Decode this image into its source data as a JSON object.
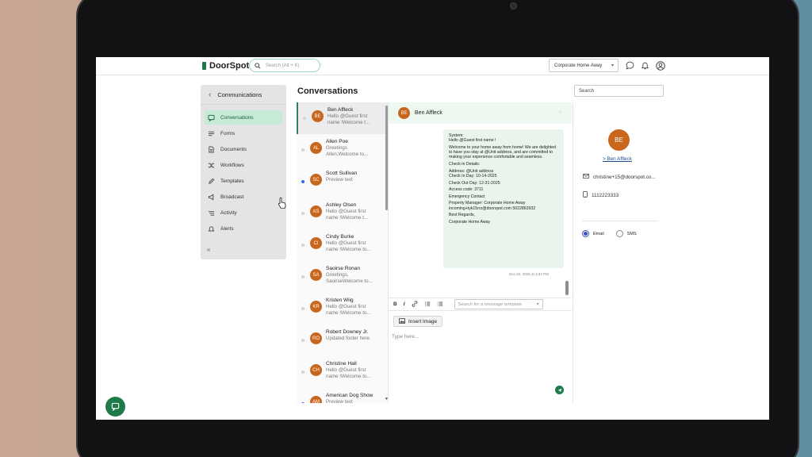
{
  "app": {
    "name": "DoorSpot"
  },
  "topbar": {
    "search_placeholder": "Search (Alt + K)",
    "org": "Corporate Home Away"
  },
  "nav": {
    "header": "Communications",
    "items": [
      {
        "label": "Conversations",
        "icon": "chat-icon",
        "active": true
      },
      {
        "label": "Forms",
        "icon": "forms-icon",
        "active": false
      },
      {
        "label": "Documents",
        "icon": "document-icon",
        "active": false
      },
      {
        "label": "Workflows",
        "icon": "workflow-icon",
        "active": false
      },
      {
        "label": "Templates",
        "icon": "pencil-icon",
        "active": false
      },
      {
        "label": "Broadcast",
        "icon": "megaphone-icon",
        "active": false
      },
      {
        "label": "Activity",
        "icon": "activity-icon",
        "active": false
      },
      {
        "label": "Alerts",
        "icon": "bell-icon",
        "active": false
      }
    ]
  },
  "conversations": {
    "title": "Conversations",
    "search_placeholder": "Search",
    "items": [
      {
        "initials": "BE",
        "name": "Ben Affleck",
        "preview": "Hello @Guest first name !Welcome t...",
        "unread": false,
        "selected": true
      },
      {
        "initials": "AL",
        "name": "Allen Poe",
        "preview": "Greetings Allen,Welcome to...",
        "unread": false,
        "selected": false
      },
      {
        "initials": "SC",
        "name": "Scott Sullivan",
        "preview": "Preview text",
        "unread": true,
        "selected": false
      },
      {
        "initials": "AS",
        "name": "Ashley Olsen",
        "preview": "Hello @Guest first name !Welcome t...",
        "unread": false,
        "selected": false
      },
      {
        "initials": "CI",
        "name": "Cindy Burke",
        "preview": "Hello @Guest first name !Welcome to...",
        "unread": false,
        "selected": false
      },
      {
        "initials": "SA",
        "name": "Saoirse Ronan",
        "preview": "Greetings, SaoirseWelcome to...",
        "unread": false,
        "selected": false
      },
      {
        "initials": "KR",
        "name": "Kristen Wiig",
        "preview": "Hello @Guest first name !Welcome to...",
        "unread": false,
        "selected": false
      },
      {
        "initials": "RO",
        "name": "Robert Downey Jr.",
        "preview": "Updated footer here",
        "unread": false,
        "selected": false
      },
      {
        "initials": "CH",
        "name": "Christine Hall",
        "preview": "Hello @Guest first name !Welcome to...",
        "unread": false,
        "selected": false
      },
      {
        "initials": "AM",
        "name": "American Dog Show",
        "preview": "Preview text",
        "unread": true,
        "selected": false
      }
    ]
  },
  "chat": {
    "header_initials": "BE",
    "header_name": "Ben Affleck",
    "message": [
      "System:\nHello @Guest first name !",
      "Welcome to your home away from home! We are delighted to have you stay at @Unit address, and are committed to making your experience comfortable and seamless.",
      "Check-in Details:",
      "Address: @Unit address\nCheck In Day: 10-14-2025",
      "Check Out Day: 12-31-2025",
      "Access code: 3711",
      "Emergency Contact",
      "Property Manager: Corporate Home Away\nincoming+tyk15rrz@doorspot.com 5022863932",
      "Best Regards,",
      "Corporate Home Away"
    ],
    "timestamp": "Dec 02, 2025 at 3:33 PM",
    "toolbar": {
      "bold": "B",
      "italic": "I",
      "template_placeholder": "Search for a message template"
    },
    "insert_image": "Insert Image",
    "compose_placeholder": "Type here..."
  },
  "details": {
    "initials": "BE",
    "name": "> Ben Affleck",
    "email": "christine+15@doorspot.co...",
    "phone": "1112223333",
    "channels": [
      {
        "label": "Email",
        "selected": true
      },
      {
        "label": "SMS",
        "selected": false
      }
    ]
  },
  "colors": {
    "brand": "#1f7a4a",
    "avatar": "#c9661d",
    "active_nav": "#c7ead6",
    "unread_dot": "#3b6fd8"
  }
}
